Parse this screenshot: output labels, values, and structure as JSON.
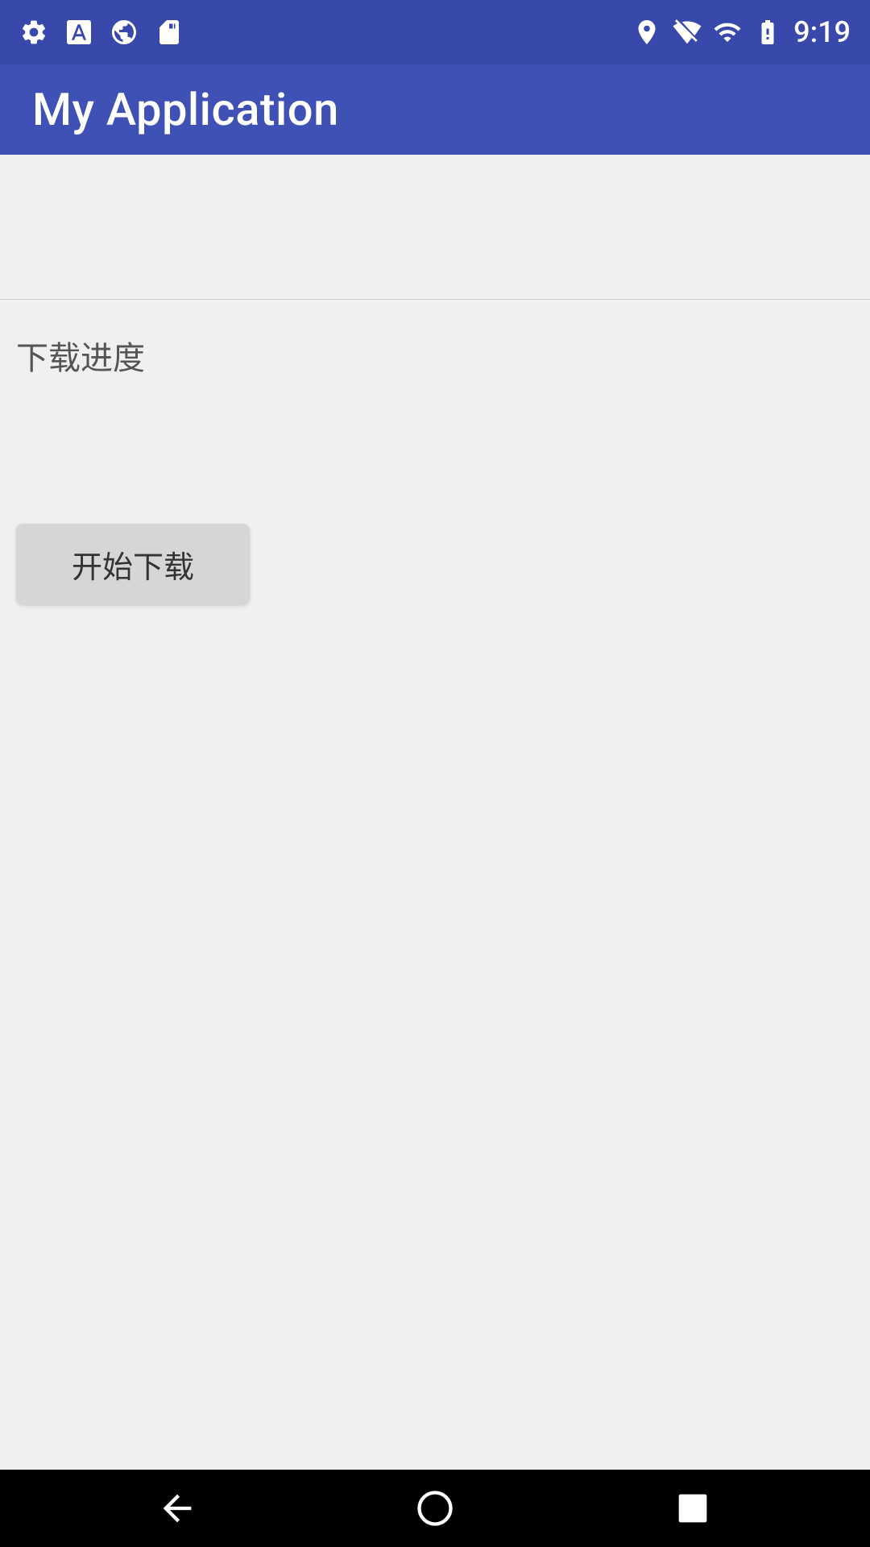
{
  "statusBar": {
    "time": "9:19",
    "leftIcons": [
      "settings-icon",
      "font-icon",
      "globe-icon",
      "sdcard-icon"
    ],
    "rightIcons": [
      "location-icon",
      "wifi-no-icon",
      "signal-icon",
      "battery-icon"
    ]
  },
  "appBar": {
    "title": "My Application"
  },
  "main": {
    "downloadLabel": "下载进度",
    "startButtonLabel": "开始下载"
  },
  "navBar": {
    "backLabel": "◀",
    "homeLabel": "⬤",
    "recentLabel": "■"
  }
}
